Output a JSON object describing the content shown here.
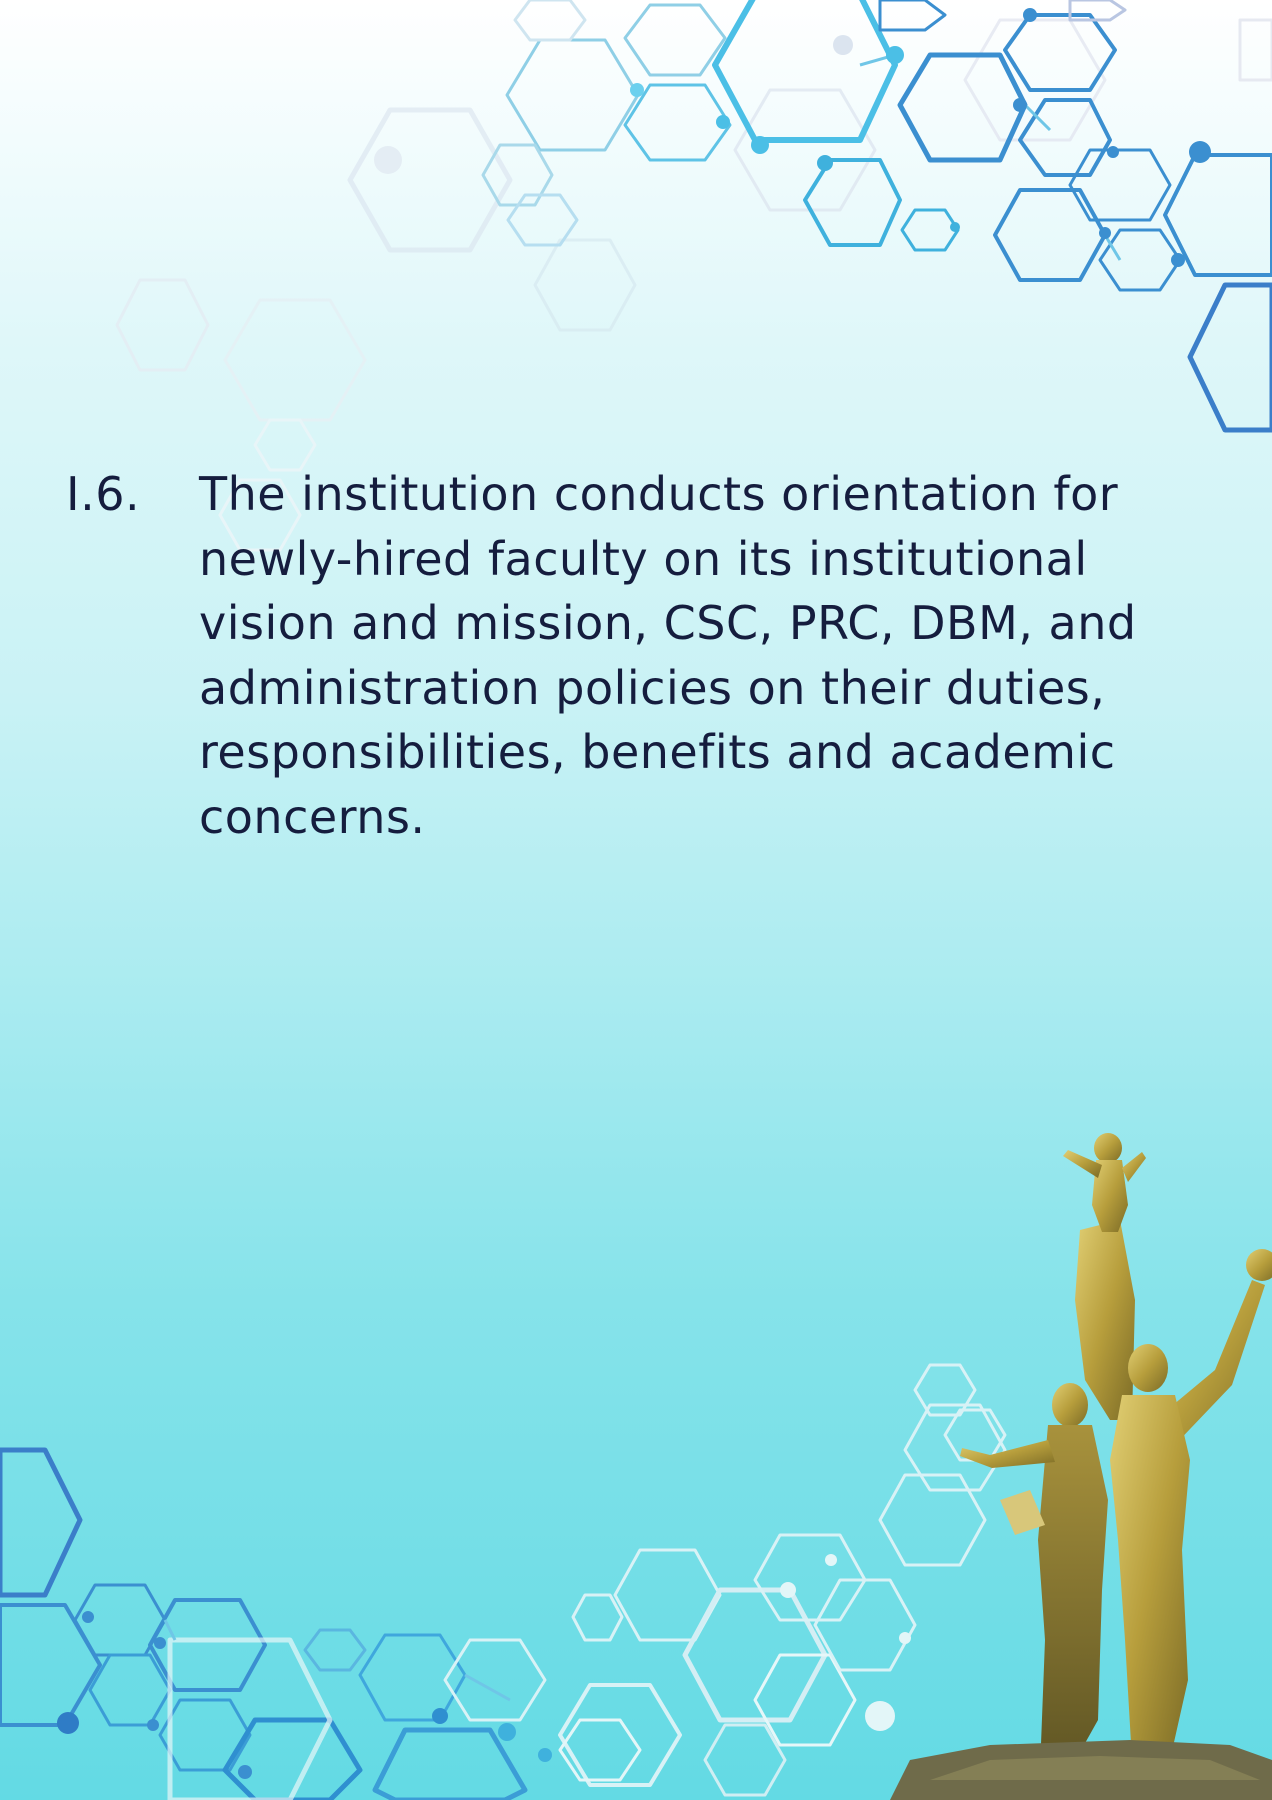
{
  "criterion": {
    "number": "I.6.",
    "text": "The institution conducts orientation for\nnewly-hired faculty on its institutional\nvision and mission, CSC, PRC, DBM, and\nadministration policies on their duties,\nresponsibilities, benefits and academic\nconcerns."
  },
  "colors": {
    "text": "#151d3e",
    "accent_blue": "#3b8fd0",
    "accent_cyan": "#4bbfe6",
    "statue_gold": "#b79e3c"
  }
}
